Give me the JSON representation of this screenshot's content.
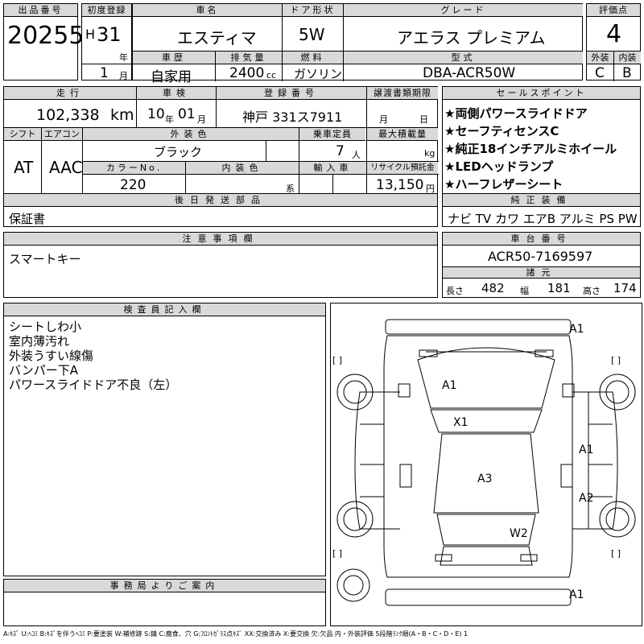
{
  "header": {
    "lot_label": "出品番号",
    "lot_no": "20255",
    "reg_label": "初度登録",
    "era": "H",
    "year": "31",
    "year_unit": "年",
    "month": "1",
    "month_unit": "月",
    "name_label": "車名",
    "name": "エスティマ",
    "door_label": "ドア形状",
    "door": "5W",
    "grade_label": "グレード",
    "grade": "アエラス プレミアム",
    "score_label": "評価点",
    "score": "4",
    "history_label": "車歴",
    "history": "自家用",
    "disp_label": "排気量",
    "disp": "2400",
    "disp_unit": "cc",
    "fuel_label": "燃料",
    "fuel": "ガソリン",
    "model_label": "型式",
    "model": "DBA-ACR50W",
    "ext_label": "外装",
    "ext": "C",
    "int_label": "内装",
    "int": "B"
  },
  "row2": {
    "mileage_label": "走行",
    "mileage": "102,338",
    "mileage_unit": "km",
    "inspection_label": "車検",
    "insp_year": "10",
    "insp_year_unit": "年",
    "insp_month": "01",
    "insp_month_unit": "月",
    "plate_label": "登録番号",
    "plate": "神戸 331ス7911",
    "transfer_label": "譲渡書類期限",
    "transfer_m": "月",
    "transfer_d": "日",
    "shift_label": "シフト",
    "shift": "AT",
    "ac_label": "エアコン",
    "ac": "AAC",
    "color_label": "外装色",
    "color": "ブラック",
    "seats_label": "乗車定員",
    "seats": "7",
    "seats_unit": "人",
    "load_label": "最大積載量",
    "load_unit": "kg",
    "colorno_label": "カラーNo.",
    "colorno": "220",
    "intcolor_label": "内装色",
    "intcolor_unit": "系",
    "import_label": "輸入車",
    "recycle_label": "リサイクル預託金",
    "recycle": "13,150",
    "recycle_unit": "円"
  },
  "sales_points": {
    "label": "セールスポイント",
    "items": [
      "★両側パワースライドドア",
      "★セーフティセンスC",
      "★純正18インチアルミホイール",
      "★LEDヘッドランプ",
      "★ハーフレザーシート"
    ]
  },
  "parts_later": {
    "label": "後日発送部品",
    "value": "保証書"
  },
  "equipment": {
    "label": "純正装備",
    "value": "ナビ TV カワ エアB アルミ PS PW"
  },
  "notes": {
    "label": "注意事項欄",
    "value": "スマートキー"
  },
  "chassis": {
    "label": "車台番号",
    "value": "ACR50-7169597"
  },
  "specs": {
    "label": "諸元",
    "len_label": "長さ",
    "len": "482",
    "wid_label": "幅",
    "wid": "181",
    "hei_label": "高さ",
    "hei": "174"
  },
  "inspector": {
    "label": "検査員記入欄",
    "lines": [
      "シートしわ小",
      "室内薄汚れ",
      "外装うすい線傷",
      "バンパー下A",
      "パワースライドドア不良（左）"
    ]
  },
  "office": {
    "label": "事務局よりご案内"
  },
  "damage_marks": [
    "A1",
    "A1",
    "X1",
    "A1",
    "A3",
    "A2",
    "W2",
    "A1"
  ],
  "bracket": "[ ]",
  "legend": "A:ｷｽﾞ U:ﾍｺﾐ B:ｷｽﾞを伴うﾍｺﾐ P:要塗装 W:補修跡 S:錆 C:腐食、穴 G:ﾌﾛﾝﾄｶﾞﾗｽ点ｷｽﾞ XX:交換済み X:要交換 欠:欠品 内・外装評価 5段階ﾗﾝｸ順(A・B・C・D・E) 1"
}
